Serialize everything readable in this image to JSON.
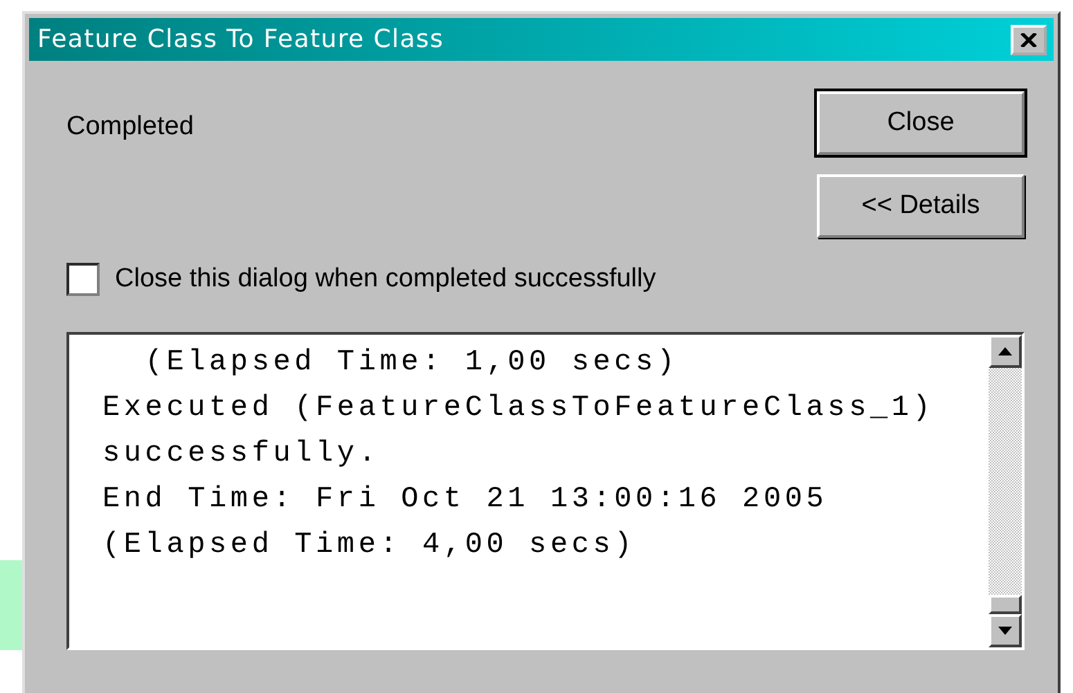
{
  "window": {
    "title": "Feature Class To Feature Class"
  },
  "status": "Completed",
  "buttons": [
    {
      "label": "Close",
      "default": true
    },
    {
      "label": "<< Details",
      "default": false
    }
  ],
  "close_when_done": {
    "label": "Close this dialog when completed successfully",
    "checked": false
  },
  "log": [
    "  (Elapsed Time: 1,00 secs)",
    "Executed (FeatureClassToFeatureClass_1)",
    "successfully.",
    "End Time: Fri Oct 21 13:00:16 2005",
    "(Elapsed Time: 4,00 secs)"
  ]
}
